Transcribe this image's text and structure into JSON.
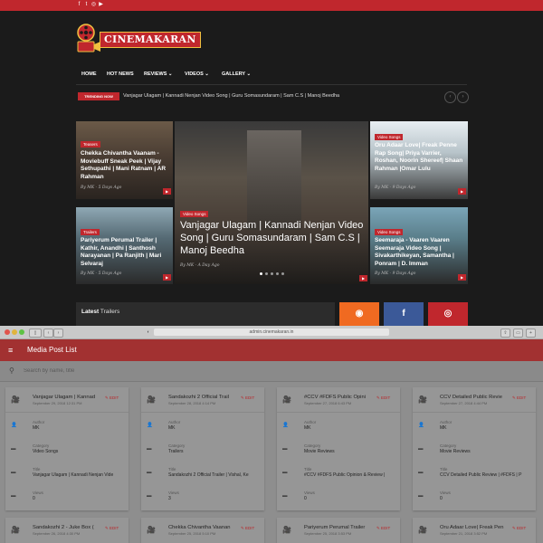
{
  "site": {
    "social_icons": [
      "facebook-icon",
      "twitter-icon",
      "instagram-icon",
      "youtube-icon"
    ],
    "social_glyphs": [
      "f",
      "t",
      "◎",
      "▶"
    ],
    "logo_text": "CINEMAKARAN",
    "nav": [
      "HOME",
      "HOT NEWS",
      "REVIEWS ⌄",
      "VIDEOS ⌄",
      "GALLERY ⌄"
    ],
    "trending": {
      "badge": "TRENDING NOW",
      "text": "Vanjagar Ulagam | Kannadi Nenjan Video Song | Guru Somasundaram | Sam C.S | Manoj Beedha",
      "prev": "‹",
      "next": "›"
    },
    "cards": {
      "top_left": {
        "tag": "Teasers",
        "title": "Chekka Chivantha Vaanam - Moviebuff Sneak Peek | Vijay Sethupathi | Mani Ratnam | AR Rahman",
        "byline": "By MK - 5 Days Ago"
      },
      "bottom_left": {
        "tag": "Trailers",
        "title": "Pariyerum Perumal Trailer | Kathir, Anandhi | Santhosh Narayanan | Pa Ranjith | Mari Selvaraj",
        "byline": "By MK - 5 Days Ago"
      },
      "center": {
        "tag": "Video Songs",
        "title": "Vanjagar Ulagam | Kannadi Nenjan Video Song | Guru Somasundaram | Sam C.S | Manoj Beedha",
        "byline": "By MK - A Day Ago"
      },
      "top_right": {
        "tag": "Video Songs",
        "title": "Oru Adaar Love| Freak Penne Rap Song| Priya Varrier, Roshan, Noorin Shereef| Shaan Rahman |Omar Lulu",
        "byline": "By MK - 9 Days Ago"
      },
      "bottom_right": {
        "tag": "Video Songs",
        "title": "Seemaraja - Vaaren Vaaren Seemaraja Video Song | Sivakarthikeyan, Samantha | Ponram | D. Imman",
        "byline": "By MK - 9 Days Ago"
      }
    },
    "play_glyph": "▶",
    "latest": {
      "bold": "Latest",
      "rest": " Trailers"
    },
    "social_boxes": [
      {
        "name": "rss-icon",
        "glyph": "◉",
        "color": "#f06a21"
      },
      {
        "name": "facebook-box-icon",
        "glyph": "f",
        "color": "#3b5998"
      },
      {
        "name": "instagram-box-icon",
        "glyph": "◎",
        "color": "#c0272d"
      }
    ],
    "colors": {
      "accent": "#c0272d",
      "bg": "#1b1b1b"
    }
  },
  "admin": {
    "browser": {
      "url": "admin.cinemakaran.in"
    },
    "app_title": "Media Post List",
    "search_placeholder": "Search by name, title",
    "field_labels": {
      "author": "Author",
      "category": "Category",
      "title": "Title",
      "views": "Views"
    },
    "edit_label": "EDIT",
    "posts": [
      {
        "title": "Vanjagar Ulagam | Kannad",
        "date": "September 29, 2018 12:31 PM",
        "author": "MK",
        "category": "Video Songs",
        "full_title": "Vanjagar Ulagam | Kannadi Nenjan Vide",
        "views": "0"
      },
      {
        "title": "Sandakozhi 2 Official Trail",
        "date": "September 28, 2018 4:14 PM",
        "author": "MK",
        "category": "Trailers",
        "full_title": "Sandakozhi 2 Official Trailer | Vishal, Ke",
        "views": "3"
      },
      {
        "title": "#CCV #FDFS Public Opini",
        "date": "September 27, 2018 6:43 PM",
        "author": "MK",
        "category": "Movie Reviews",
        "full_title": "#CCV #FDFS Public Opinion & Review |",
        "views": "0"
      },
      {
        "title": "CCV Detailed Public Revie",
        "date": "September 27, 2018 4:44 PM",
        "author": "MK",
        "category": "Movie Reviews",
        "full_title": "CCV Detailed Public Review | #FDFS | P",
        "views": "0"
      },
      {
        "title": "Sandakozhi 2 - Juke Box (",
        "date": "September 26, 2018 4:30 PM",
        "author": "",
        "category": "",
        "full_title": "",
        "views": ""
      },
      {
        "title": "Chekka Chivantha Vaanan",
        "date": "September 25, 2018 5:10 PM",
        "author": "",
        "category": "",
        "full_title": "",
        "views": ""
      },
      {
        "title": "Pariyerum Perumal Trailer",
        "date": "September 25, 2018 3:53 PM",
        "author": "",
        "category": "",
        "full_title": "",
        "views": ""
      },
      {
        "title": "Oru Adaar Love| Freak Pen",
        "date": "September 21, 2018 3:52 PM",
        "author": "",
        "category": "",
        "full_title": "",
        "views": ""
      }
    ]
  }
}
